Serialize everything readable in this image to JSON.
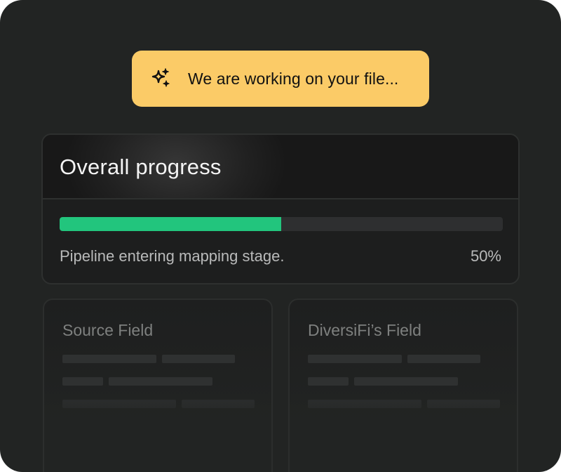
{
  "toast": {
    "icon": "sparkle-icon",
    "message": "We are working on your file..."
  },
  "progress": {
    "title": "Overall progress",
    "status": "Pipeline entering mapping stage.",
    "percent_label": "50%",
    "fraction": 0.5
  },
  "fields": [
    {
      "title": "Source Field"
    },
    {
      "title": "DiversiFi’s Field"
    }
  ],
  "colors": {
    "background": "#222423",
    "toast": "#FBCB67",
    "progress_fill": "#22C57D",
    "progress_track": "#2E2F30"
  }
}
